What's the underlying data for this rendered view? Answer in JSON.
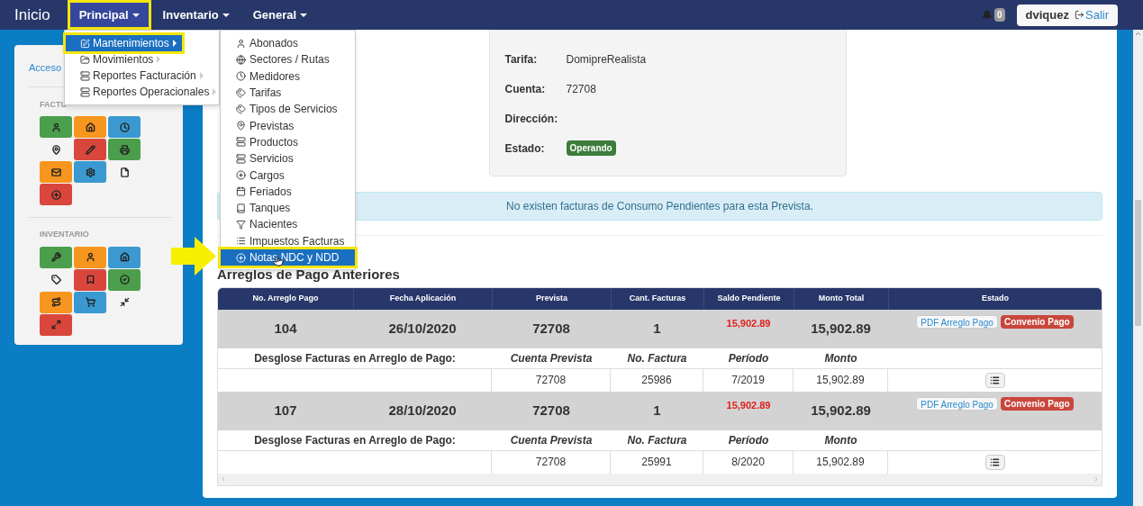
{
  "nav": {
    "brand": "Inicio",
    "menus": [
      {
        "label": "Principal",
        "selected": true
      },
      {
        "label": "Inventario",
        "selected": false
      },
      {
        "label": "General",
        "selected": false
      }
    ],
    "notifications": "0",
    "user": "dviquez",
    "logout": "Salir"
  },
  "principal_menu": {
    "items": [
      {
        "label": "Mantenimientos",
        "selected": true
      },
      {
        "label": "Movimientos",
        "selected": false
      },
      {
        "label": "Reportes Facturación",
        "selected": false
      },
      {
        "label": "Reportes Operacionales",
        "selected": false
      }
    ]
  },
  "submenu": {
    "items": [
      {
        "label": "Abonados",
        "selected": false
      },
      {
        "label": "Sectores / Rutas",
        "selected": false
      },
      {
        "label": "Medidores",
        "selected": false
      },
      {
        "label": "Tarifas",
        "selected": false
      },
      {
        "label": "Tipos de Servicios",
        "selected": false
      },
      {
        "label": "Previstas",
        "selected": false
      },
      {
        "label": "Productos",
        "selected": false
      },
      {
        "label": "Servicios",
        "selected": false
      },
      {
        "label": "Cargos",
        "selected": false
      },
      {
        "label": "Feriados",
        "selected": false
      },
      {
        "label": "Tanques",
        "selected": false
      },
      {
        "label": "Nacientes",
        "selected": false
      },
      {
        "label": "Impuestos Facturas",
        "selected": false
      },
      {
        "label": "Notas NDC y NDD",
        "selected": true
      }
    ]
  },
  "sidebar": {
    "link": "Acceso",
    "sections": [
      {
        "title": "FACTU",
        "tiles": [
          {
            "color": "#4b9e4b"
          },
          {
            "color": "#f7961e"
          },
          {
            "color": "#3a99d0"
          },
          {
            "color": "#f4f4f4"
          },
          {
            "color": "#d9473c"
          },
          {
            "color": "#4b9e4b"
          },
          {
            "color": "#f7961e"
          },
          {
            "color": "#3a99d0"
          },
          {
            "color": "#f4f4f4"
          },
          {
            "color": "#d9473c"
          }
        ]
      },
      {
        "title": "INVENTARIO",
        "tiles": [
          {
            "color": "#4b9e4b"
          },
          {
            "color": "#f7961e"
          },
          {
            "color": "#3a99d0"
          },
          {
            "color": "#f4f4f4"
          },
          {
            "color": "#d9473c"
          },
          {
            "color": "#4b9e4b"
          },
          {
            "color": "#f7961e"
          },
          {
            "color": "#3a99d0"
          },
          {
            "color": "#f4f4f4"
          },
          {
            "color": "#d9473c"
          }
        ]
      }
    ]
  },
  "info": {
    "fields": [
      {
        "label": "Tarifa:",
        "value": "DomipreRealista",
        "kind": "text"
      },
      {
        "label": "Cuenta:",
        "value": "72708",
        "kind": "text"
      },
      {
        "label": "Dirección:",
        "kind": "text"
      },
      {
        "label": "Estado:",
        "value": "Operando",
        "kind": "badge"
      }
    ]
  },
  "alert": "No existen facturas de Consumo Pendientes para esta Prevista.",
  "table": {
    "title": "Arreglos de Pago Anteriores",
    "columns": [
      "No. Arreglo Pago",
      "Fecha Aplicación",
      "Prevista",
      "Cant. Facturas",
      "Saldo Pendiente",
      "Monto Total",
      "Estado"
    ],
    "rows": [
      {
        "cells": [
          "104",
          "26/10/2020",
          "72708",
          "1"
        ],
        "saldo": "15,902.89",
        "monto": "15,902.89",
        "actions": [
          "PDF Arreglo Pago",
          "Convenio Pago"
        ],
        "breakdown_label": "Desglose Facturas en Arreglo de Pago:",
        "breakdown_columns": [
          "Cuenta Prevista",
          "No. Factura",
          "Período",
          "Monto"
        ],
        "detail": [
          "72708",
          "25986",
          "7/2019",
          "15,902.89"
        ]
      },
      {
        "cells": [
          "107",
          "28/10/2020",
          "72708",
          "1"
        ],
        "saldo": "15,902.89",
        "monto": "15,902.89",
        "actions": [
          "PDF Arreglo Pago",
          "Convenio Pago"
        ],
        "breakdown_label": "Desglose Facturas en Arreglo de Pago:",
        "breakdown_columns": [
          "Cuenta Prevista",
          "No. Factura",
          "Período",
          "Monto"
        ],
        "detail": [
          "72708",
          "25991",
          "8/2020",
          "15,902.89"
        ]
      }
    ]
  }
}
